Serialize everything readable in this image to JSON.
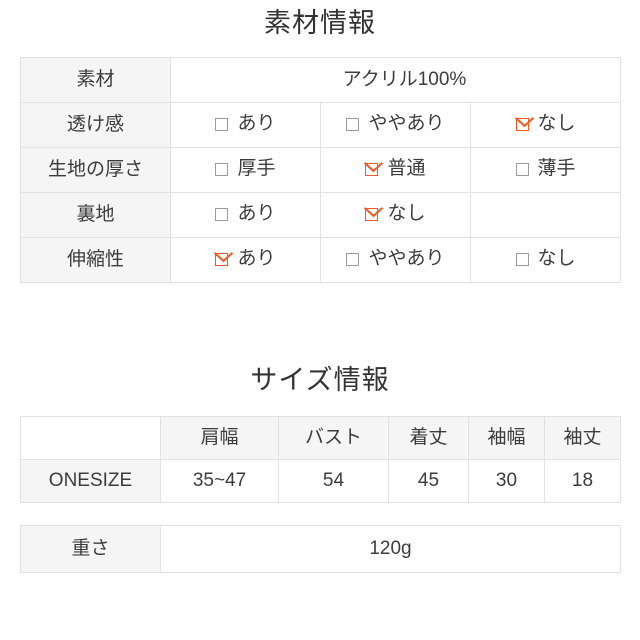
{
  "material_section": {
    "title": "素材情報",
    "rows": [
      {
        "label": "素材",
        "type": "text",
        "value": "アクリル100%"
      },
      {
        "label": "透け感",
        "type": "options",
        "options": [
          {
            "label": "あり",
            "checked": false
          },
          {
            "label": "ややあり",
            "checked": false
          },
          {
            "label": "なし",
            "checked": true
          }
        ]
      },
      {
        "label": "生地の厚さ",
        "type": "options",
        "options": [
          {
            "label": "厚手",
            "checked": false
          },
          {
            "label": "普通",
            "checked": true
          },
          {
            "label": "薄手",
            "checked": false
          }
        ]
      },
      {
        "label": "裏地",
        "type": "options",
        "options": [
          {
            "label": "あり",
            "checked": false
          },
          {
            "label": "なし",
            "checked": true
          },
          {
            "label": "",
            "checked": false,
            "empty": true
          }
        ]
      },
      {
        "label": "伸縮性",
        "type": "options",
        "options": [
          {
            "label": "あり",
            "checked": true
          },
          {
            "label": "ややあり",
            "checked": false
          },
          {
            "label": "なし",
            "checked": false
          }
        ]
      }
    ]
  },
  "size_section": {
    "title": "サイズ情報",
    "headers": [
      "",
      "肩幅",
      "バスト",
      "着丈",
      "袖幅",
      "袖丈"
    ],
    "rows": [
      [
        "ONESIZE",
        "35~47",
        "54",
        "45",
        "30",
        "18"
      ]
    ]
  },
  "weight_section": {
    "label": "重さ",
    "value": "120g"
  },
  "footnote": {
    "text": ""
  },
  "colors": {
    "material_value": "#f4407f",
    "checked_box": "#f05a22",
    "unchecked_box": "#9a9a9a",
    "border": "#e2e2e2",
    "label_bg": "#f5f5f5",
    "title_text": "#333333"
  }
}
